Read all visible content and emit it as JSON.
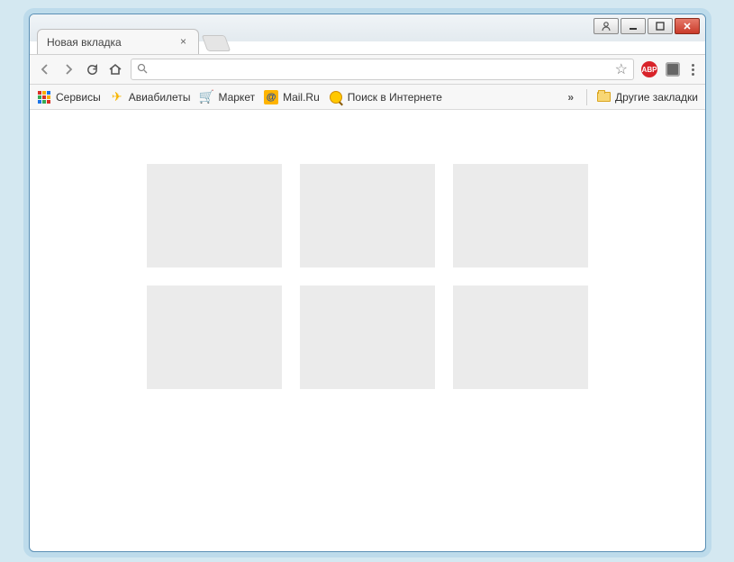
{
  "tab": {
    "title": "Новая вкладка"
  },
  "omnibox": {
    "value": "",
    "placeholder": ""
  },
  "bookmarks": {
    "apps": "Сервисы",
    "flights": "Авиабилеты",
    "market": "Маркет",
    "mailru": "Mail.Ru",
    "websearch": "Поиск в Интернете",
    "overflow": "»",
    "other": "Другие закладки"
  },
  "extensions": {
    "abp": "ABP"
  }
}
